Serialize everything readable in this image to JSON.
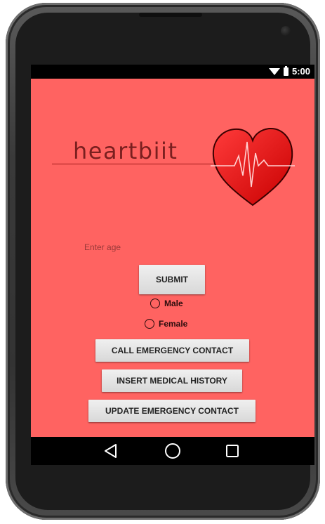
{
  "status_bar": {
    "time": "5:00",
    "wifi_icon": "wifi-icon",
    "battery_icon": "battery-icon"
  },
  "app": {
    "background_color": "#ff6361",
    "logo": {
      "text": "heartbiit",
      "icon": "heart-ecg-icon"
    },
    "age_field": {
      "placeholder": "Enter age",
      "value": ""
    },
    "submit_label": "SUBMIT",
    "gender_options": [
      {
        "label": "Male",
        "selected": false
      },
      {
        "label": "Female",
        "selected": false
      }
    ],
    "buttons": {
      "call_emergency": "CALL EMERGENCY CONTACT",
      "insert_history": "INSERT MEDICAL HISTORY",
      "update_emergency": "UPDATE EMERGENCY CONTACT"
    }
  },
  "nav_bar": {
    "back_icon": "back-triangle-icon",
    "home_icon": "home-circle-icon",
    "recent_icon": "recent-apps-square-icon"
  }
}
